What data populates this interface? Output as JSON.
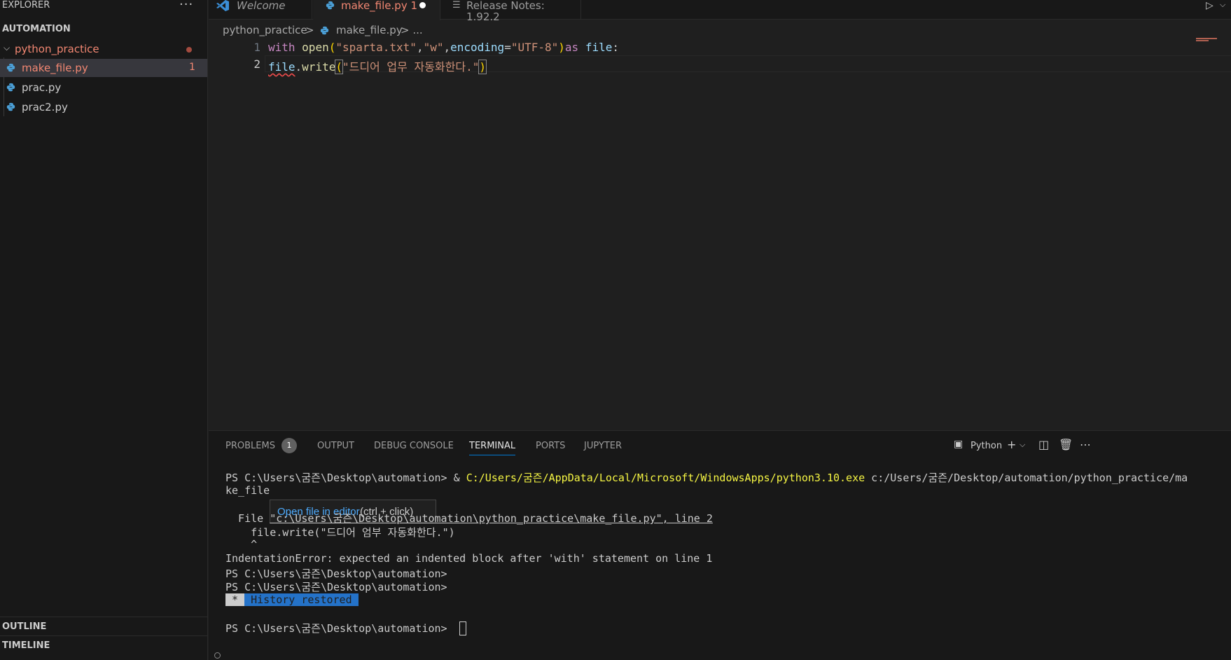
{
  "sidebar": {
    "title": "EXPLORER",
    "more": "···",
    "section": "AUTOMATION",
    "folder": "python_practice",
    "files": [
      {
        "name": "make_file.py",
        "count": "1"
      },
      {
        "name": "prac.py",
        "count": ""
      },
      {
        "name": "prac2.py",
        "count": ""
      }
    ],
    "outline": "OUTLINE",
    "timeline": "TIMELINE"
  },
  "tabs": {
    "welcome": "Welcome",
    "make_file": "make_file.py 1",
    "release": "Release Notes: 1.92.2"
  },
  "breadcrumb": {
    "folder": "python_practice",
    "sep": ">",
    "file": "make_file.py",
    "more": "> ..."
  },
  "editor": {
    "line_numbers": [
      "1",
      "2"
    ],
    "line1": {
      "kw_with": "with",
      "fn_open": "open",
      "p1": "(",
      "s1": "\"sparta.txt\"",
      "c1": ",",
      "s2": "\"w\"",
      "c2": ",",
      "param": "encoding",
      "eq": "=",
      "s3": "\"UTF-8\"",
      "p2": ")",
      "kw_as": "as",
      "var": "file",
      "colon": ":"
    },
    "line2": {
      "var": "file",
      "dot": ".",
      "fn": "write",
      "p1": "(",
      "s1": "\"드디어 업무 자동화한다.\"",
      "p2": ")"
    }
  },
  "panel": {
    "tabs": [
      "PROBLEMS",
      "OUTPUT",
      "DEBUG CONSOLE",
      "TERMINAL",
      "PORTS",
      "JUPYTER"
    ],
    "problems_count": "1",
    "shell_label": "Python",
    "terminal": {
      "line1_prompt": "PS C:\\Users\\굼즌\\Desktop\\automation> & ",
      "line1_exe": "C:/Users/굼즌/AppData/Local/Microsoft/WindowsApps/python3.10.exe",
      "line1_arg": " c:/Users/굼즌/Desktop/automation/python_practice/ma",
      "line2": "ke_file",
      "tooltip_link": "Open file in editor",
      "tooltip_hint": "(ctrl + click)",
      "file_prefix": "  File ",
      "file_link": "\"c:\\Users\\굼즌\\Desktop\\automation\\python_practice\\make_file.py\", line 2",
      "code_line": "    file.write(\"드디어 엄부 자동화한다.\")",
      "caret": "    ^",
      "error": "IndentationError: expected an indented block after 'with' statement on line 1",
      "prompt": "PS C:\\Users\\굼즌\\Desktop\\automation>",
      "history_star": " * ",
      "history": " History restored "
    }
  }
}
